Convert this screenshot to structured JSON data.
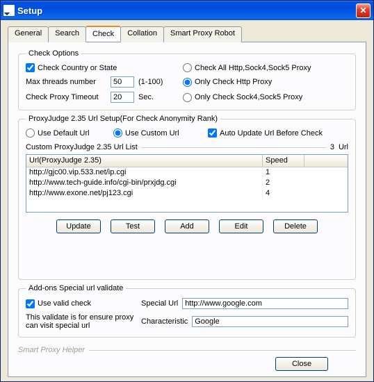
{
  "window": {
    "title": "Setup"
  },
  "tabs": [
    "General",
    "Search",
    "Check",
    "Collation",
    "Smart Proxy Robot"
  ],
  "activeTab": 2,
  "checkOptions": {
    "legend": "Check Options",
    "checkCountry": {
      "label": "Check Country or State",
      "checked": true
    },
    "maxThreadsLabel": "Max threads number",
    "maxThreads": "50",
    "maxThreadsRange": "(1-100)",
    "timeoutLabel": "Check Proxy Timeout",
    "timeout": "20",
    "timeoutUnit": "Sec.",
    "modes": {
      "all": {
        "label": "Check All Http,Sock4,Sock5 Proxy",
        "selected": false
      },
      "http": {
        "label": "Only Check Http Proxy",
        "selected": true
      },
      "sock": {
        "label": "Only Check Sock4,Sock5 Proxy",
        "selected": false
      }
    }
  },
  "proxyJudge": {
    "legend": "ProxyJudge 2.35 Url Setup(For Check Anonymity Rank)",
    "useDefault": {
      "label": "Use Default Url",
      "selected": false
    },
    "useCustom": {
      "label": "Use Custom Url",
      "selected": true
    },
    "autoUpdate": {
      "label": "Auto Update Url Before Check",
      "checked": true
    },
    "listLabel": "Custom ProxyJudge 2.35 Url List",
    "count": "3",
    "countUnit": "Url",
    "columns": {
      "url": "Url(ProxyJudge 2.35)",
      "speed": "Speed"
    },
    "rows": [
      {
        "url": "http://gjc00.vip.533.net/ip.cgi",
        "speed": "1"
      },
      {
        "url": "http://www.tech-guide.info/cgi-bin/prxjdg.cgi",
        "speed": "2"
      },
      {
        "url": "http://www.exone.net/pj123.cgi",
        "speed": "4"
      }
    ],
    "buttons": {
      "update": "Update",
      "test": "Test",
      "add": "Add",
      "edit": "Edit",
      "delete": "Delete"
    }
  },
  "addons": {
    "legend": "Add-ons Special url validate",
    "useValid": {
      "label": "Use valid check",
      "checked": true
    },
    "note": "This validate is for ensure proxy can visit special url",
    "specialLabel": "Special Url",
    "specialValue": "http://www.google.com",
    "charLabel": "Characteristic",
    "charValue": "Google"
  },
  "footer": {
    "helper": "Smart Proxy Helper",
    "close": "Close"
  }
}
